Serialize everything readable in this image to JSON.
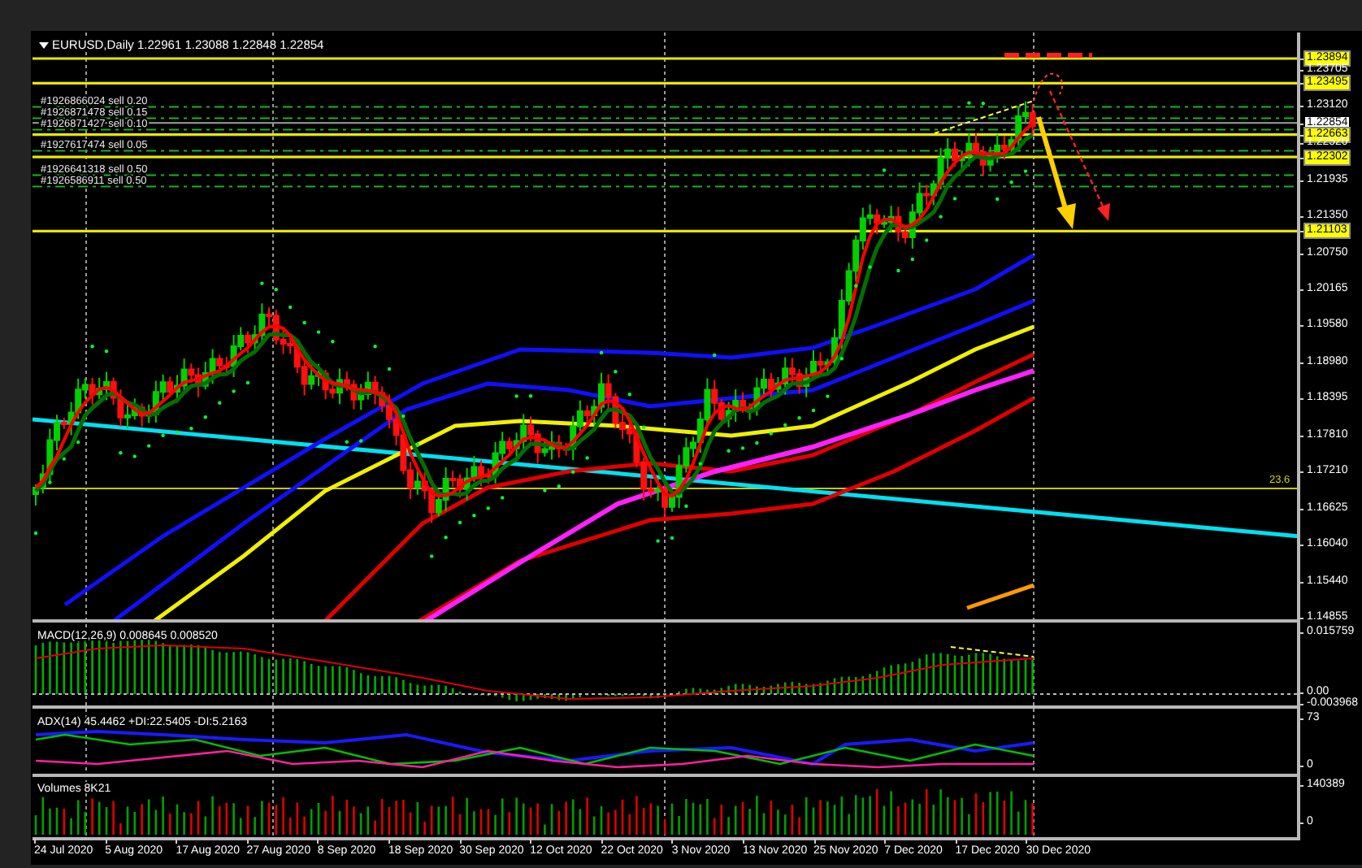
{
  "chart": {
    "title": "EURUSD,Daily 1.22961 1.23088 1.22848 1.22854",
    "orders": [
      {
        "label": "#1926866024 sell 0.20"
      },
      {
        "label": "#1926871478 sell 0.15"
      },
      {
        "label": "#1926871427 sell 0.10"
      },
      {
        "label": "#1927617474 sell 0.05"
      },
      {
        "label": "#1926641318 sell 0.50"
      },
      {
        "label": "#1926586911 sell 0.50"
      }
    ],
    "fib_label": "23.6",
    "price_scale": [
      {
        "label": "1.23894",
        "kind": "level"
      },
      {
        "label": "1.23705",
        "kind": "tick"
      },
      {
        "label": "1.23495",
        "kind": "level"
      },
      {
        "label": "1.23120",
        "kind": "tick"
      },
      {
        "label": "1.22854",
        "kind": "current"
      },
      {
        "label": "1.22663",
        "kind": "level"
      },
      {
        "label": "1.22520",
        "kind": "tick"
      },
      {
        "label": "1.22302",
        "kind": "level"
      },
      {
        "label": "1.21935",
        "kind": "tick"
      },
      {
        "label": "1.21350",
        "kind": "tick"
      },
      {
        "label": "1.21103",
        "kind": "level"
      },
      {
        "label": "1.20750",
        "kind": "tick"
      },
      {
        "label": "1.20165",
        "kind": "tick"
      },
      {
        "label": "1.19580",
        "kind": "tick"
      },
      {
        "label": "1.18980",
        "kind": "tick"
      },
      {
        "label": "1.18395",
        "kind": "tick"
      },
      {
        "label": "1.17810",
        "kind": "tick"
      },
      {
        "label": "1.17210",
        "kind": "tick"
      },
      {
        "label": "1.16625",
        "kind": "tick"
      },
      {
        "label": "1.16040",
        "kind": "tick"
      },
      {
        "label": "1.15440",
        "kind": "tick"
      },
      {
        "label": "1.14855",
        "kind": "tick"
      }
    ],
    "macd": {
      "label": "MACD(12,26,9) 0.008645 0.008520",
      "scale": [
        {
          "label": "0.015759",
          "kind": "max"
        },
        {
          "label": "0.00",
          "kind": "zero"
        },
        {
          "label": "-0.003968",
          "kind": "min"
        }
      ]
    },
    "adx": {
      "label": "ADX(14) 45.4462 +DI:22.5405 -DI:5.2163",
      "scale": [
        {
          "label": "73",
          "kind": "max"
        },
        {
          "label": "0",
          "kind": "min"
        }
      ]
    },
    "volumes": {
      "label": "Volumes 8K21",
      "scale": [
        {
          "label": "140389",
          "kind": "max"
        },
        {
          "label": "0",
          "kind": "min"
        }
      ]
    },
    "dates": [
      "24 Jul 2020",
      "5 Aug 2020",
      "17 Aug 2020",
      "27 Aug 2020",
      "8 Sep 2020",
      "18 Sep 2020",
      "30 Sep 2020",
      "12 Oct 2020",
      "22 Oct 2020",
      "3 Nov 2020",
      "13 Nov 2020",
      "25 Nov 2020",
      "7 Dec 2020",
      "17 Dec 2020",
      "30 Dec 2020"
    ]
  }
}
